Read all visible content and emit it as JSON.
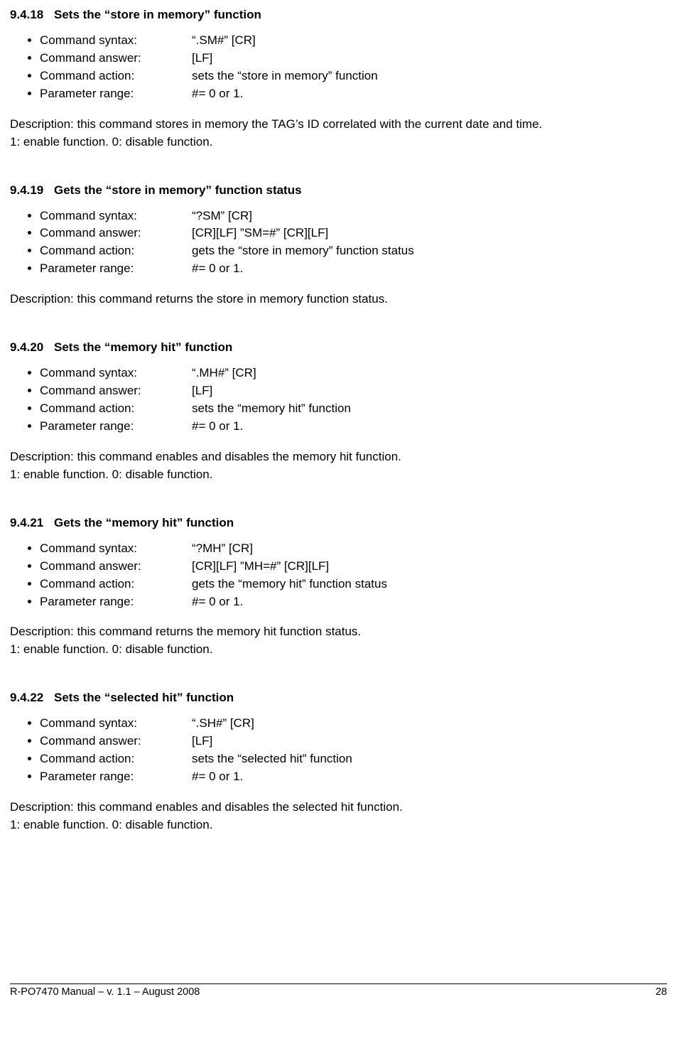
{
  "labels": {
    "syntax": "Command syntax:",
    "answer": "Command answer:",
    "action": "Command action:",
    "range": "Parameter range:"
  },
  "sections": [
    {
      "num": "9.4.18",
      "title": "Sets the “store in memory” function",
      "syntax": "“.SM#” [CR]",
      "answer": "[LF]",
      "action": "sets the “store in memory” function",
      "range": "#= 0 or 1.",
      "desc": [
        "Description: this command stores in memory the TAG’s ID correlated with the current date and time.",
        "1: enable function. 0: disable function."
      ]
    },
    {
      "num": "9.4.19",
      "title": "Gets the “store in memory” function status",
      "syntax": "“?SM” [CR]",
      "answer": "[CR][LF] ”SM=#” [CR][LF]",
      "action": "gets the “store in memory” function status",
      "range": "#= 0 or 1.",
      "desc": [
        "Description: this command returns the store in memory function status."
      ]
    },
    {
      "num": "9.4.20",
      "title": "Sets the “memory hit” function",
      "syntax": "“.MH#” [CR]",
      "answer": "[LF]",
      "action": "sets the “memory hit” function",
      "range": "#= 0 or 1.",
      "desc": [
        "Description: this command enables and disables the memory hit function.",
        "1: enable function. 0: disable function."
      ]
    },
    {
      "num": "9.4.21",
      "title": "Gets the “memory hit” function",
      "syntax": "“?MH” [CR]",
      "answer": "[CR][LF] ”MH=#” [CR][LF]",
      "action": "gets the “memory hit” function status",
      "range": "#= 0 or 1.",
      "desc": [
        "Description: this command returns the memory hit function status.",
        "1: enable function. 0: disable function."
      ]
    },
    {
      "num": "9.4.22",
      "title": "Sets the “selected hit” function",
      "syntax": "“.SH#” [CR]",
      "answer": "[LF]",
      "action": "sets the “selected hit” function",
      "range": "#= 0 or 1.",
      "desc": [
        "Description: this command enables and disables the selected hit function.",
        "1: enable function. 0: disable function."
      ]
    }
  ],
  "footer": {
    "left": "R-PO7470 Manual – v. 1.1 – August 2008",
    "right": "28"
  }
}
